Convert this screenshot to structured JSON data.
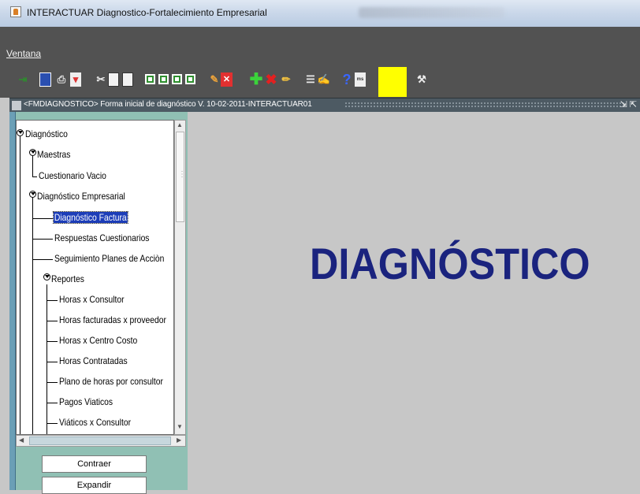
{
  "window": {
    "title": "INTERACTUAR Diagnostico-Fortalecimiento Empresarial"
  },
  "menu": {
    "items": [
      "Ventana"
    ]
  },
  "toolbar": {
    "icons": [
      "exit-icon",
      "save-icon",
      "print-icon",
      "filter-icon",
      "cut-icon",
      "copy-icon",
      "paste-icon",
      "first-record-icon",
      "previous-record-icon",
      "next-record-icon",
      "last-record-icon",
      "query-icon",
      "cancel-query-icon",
      "insert-record-icon",
      "delete-record-icon",
      "edit-icon",
      "list-icon",
      "notes-icon",
      "help-icon",
      "info-icon",
      "tools-icon"
    ],
    "accent_color": "#ffff00"
  },
  "form": {
    "title": "<FMDIAGNOSTICO> Forma inicial de diagnóstico V. 10-02-2011-INTERACTUAR01"
  },
  "tree": {
    "root": "Diagnóstico",
    "maestras": "Maestras",
    "cuestionario_vacio": "Cuestionario Vacio",
    "diagnostico_empresarial": "Diagnóstico Empresarial",
    "diagnostico_factura": "Diagnóstico Factura",
    "respuestas": "Respuestas Cuestionarios",
    "seguimiento": "Seguimiento Planes de Acciòn",
    "reportes": "Reportes",
    "reports": [
      "Horas x Consultor",
      "Horas facturadas x proveedor",
      "Horas x Centro Costo",
      "Horas Contratadas",
      "Plano de horas por consultor",
      "Pagos Viaticos",
      "Viáticos x Consultor"
    ]
  },
  "buttons": {
    "collapse": "Contraer",
    "expand": "Expandir"
  },
  "main": {
    "heading": "DIAGNÓSTICO",
    "heading_color": "#1a237e"
  }
}
